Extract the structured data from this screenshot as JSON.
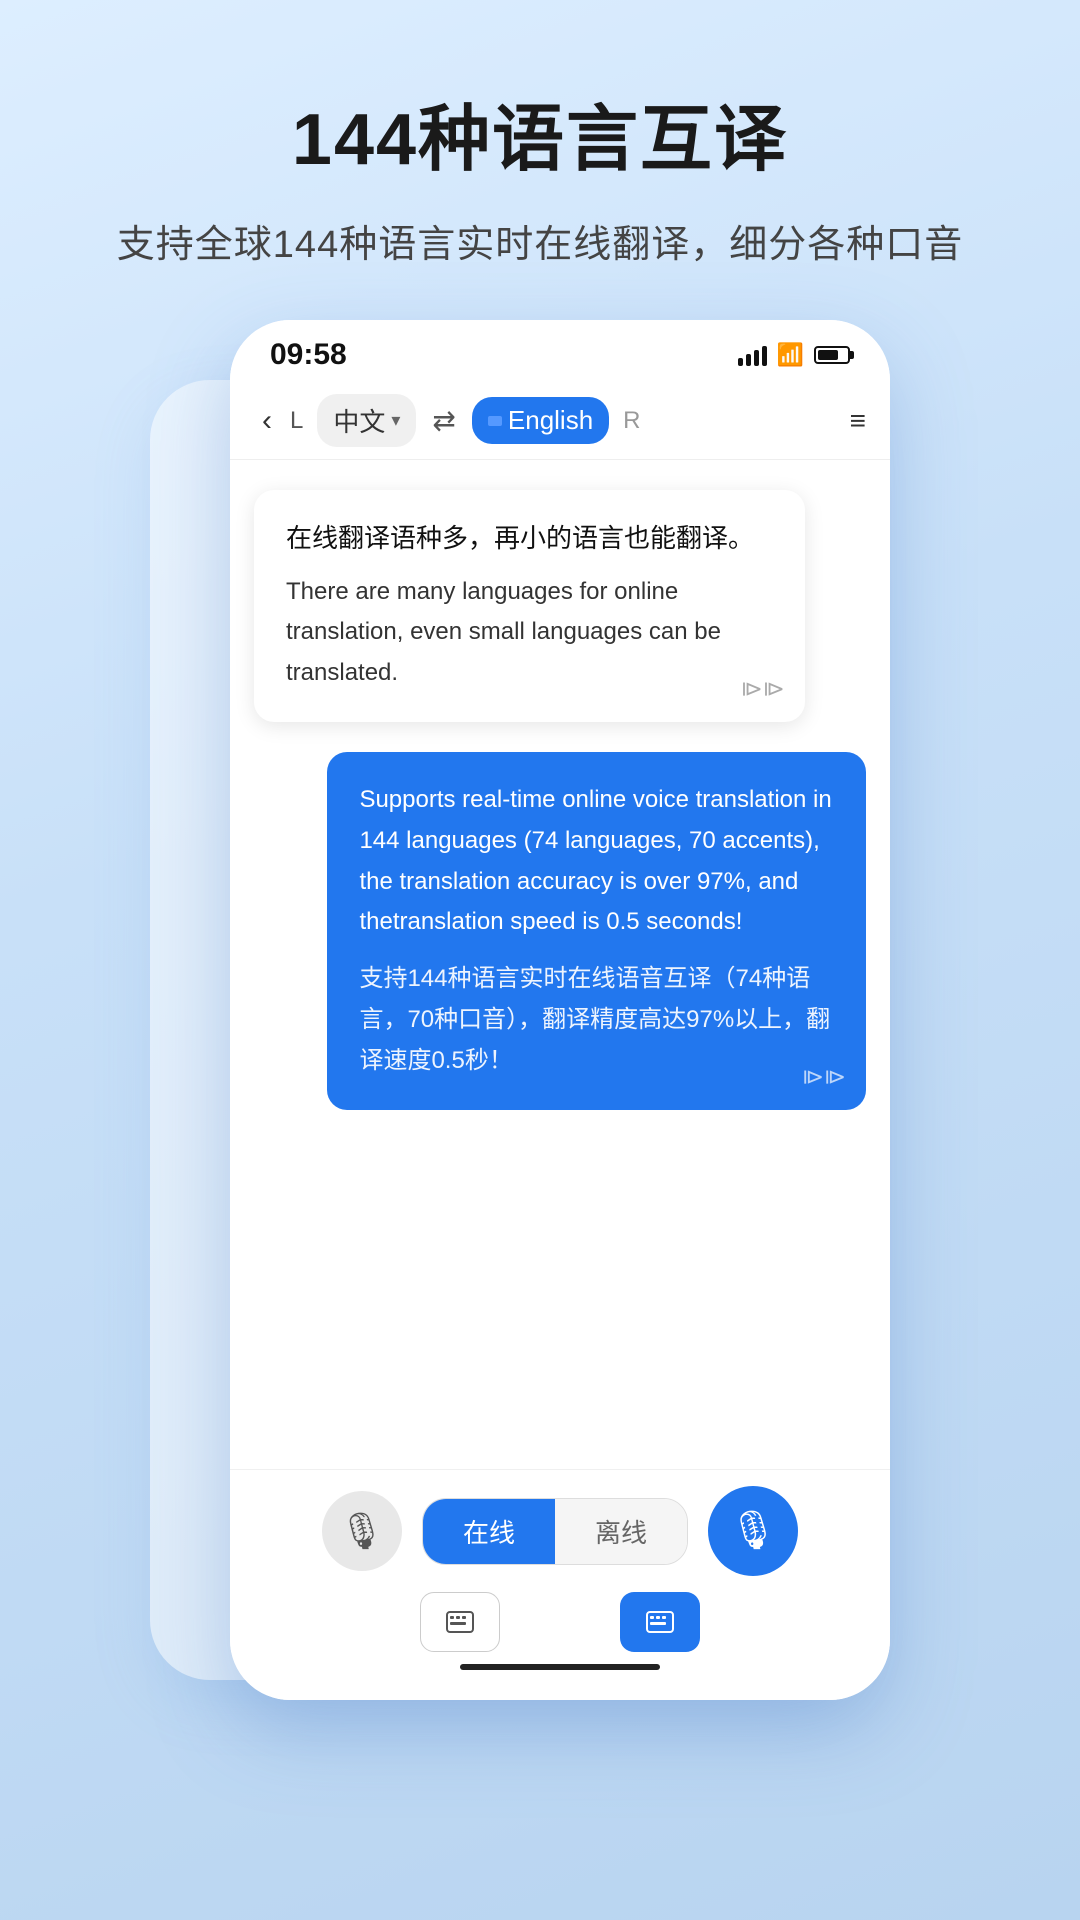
{
  "page": {
    "title": "144种语言互译",
    "subtitle": "支持全球144种语言实时在线翻译，细分各种口音"
  },
  "phone": {
    "status": {
      "time": "09:58"
    },
    "nav": {
      "back": "‹",
      "lang_left_prefix": "L",
      "lang_left": "中文",
      "swap": "⇄",
      "lang_right_prefix": "▾",
      "lang_right": "English",
      "lang_right_suffix": "R",
      "menu": "≡"
    },
    "bubbles": {
      "left_cn": "在线翻译语种多，再小的语言也能翻译。",
      "left_en": "There are many languages for online translation, even small languages can be translated.",
      "right_en": "Supports real-time online voice translation in 144 languages (74 languages, 70 accents), the translation accuracy is over 97%, and thetranslation speed is 0.5 seconds!",
      "right_cn": "支持144种语言实时在线语音互译（74种语言，70种口音），翻译精度高达97%以上，翻译速度0.5秒！"
    },
    "bottom": {
      "online_label": "在线",
      "offline_label": "离线"
    }
  }
}
